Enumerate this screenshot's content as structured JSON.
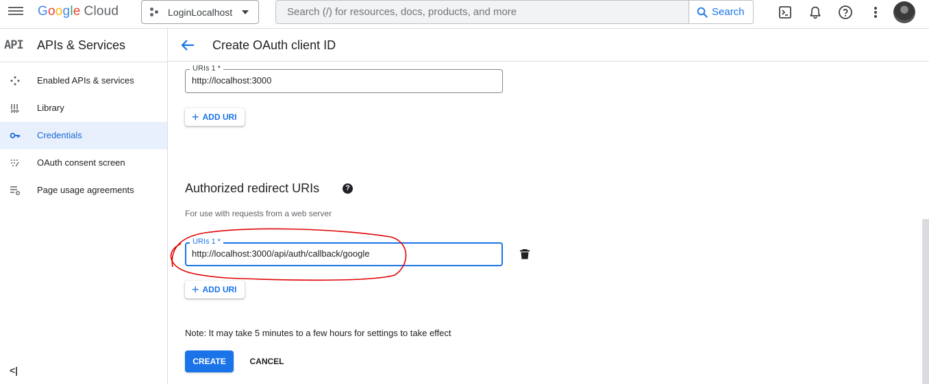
{
  "topbar": {
    "logo_google": [
      "G",
      "o",
      "o",
      "g",
      "l",
      "e"
    ],
    "logo_cloud": "Cloud",
    "project_name": "LoginLocalhost",
    "search_placeholder": "Search (/) for resources, docs, products, and more",
    "search_button": "Search",
    "icons": [
      "cloud-shell-icon",
      "notifications-icon",
      "help-icon",
      "more-vert-icon"
    ]
  },
  "sidebar": {
    "badge": "API",
    "title": "APIs & Services",
    "items": [
      {
        "label": "Enabled APIs & services",
        "icon": "enabled-apis-icon",
        "active": false
      },
      {
        "label": "Library",
        "icon": "library-icon",
        "active": false
      },
      {
        "label": "Credentials",
        "icon": "key-icon",
        "active": true
      },
      {
        "label": "OAuth consent screen",
        "icon": "consent-icon",
        "active": false
      },
      {
        "label": "Page usage agreements",
        "icon": "settings-list-icon",
        "active": false
      }
    ],
    "collapse_glyph": "<|"
  },
  "header": {
    "title": "Create OAuth client ID"
  },
  "origins": {
    "field_label": "URIs 1 *",
    "field_value": "http://localhost:3000",
    "add_button": "ADD URI"
  },
  "redirect": {
    "title": "Authorized redirect URIs",
    "help_glyph": "?",
    "description": "For use with requests from a web server",
    "field_label": "URIs 1 *",
    "field_value": "http://localhost:3000/api/auth/callback/google",
    "add_button": "ADD URI"
  },
  "footer": {
    "note": "Note: It may take 5 minutes to a few hours for settings to take effect",
    "create_button": "CREATE",
    "cancel_button": "CANCEL"
  },
  "colors": {
    "accent": "#1a73e8",
    "active_nav_bg": "#e8f0fe",
    "annotation": "#e00000"
  }
}
